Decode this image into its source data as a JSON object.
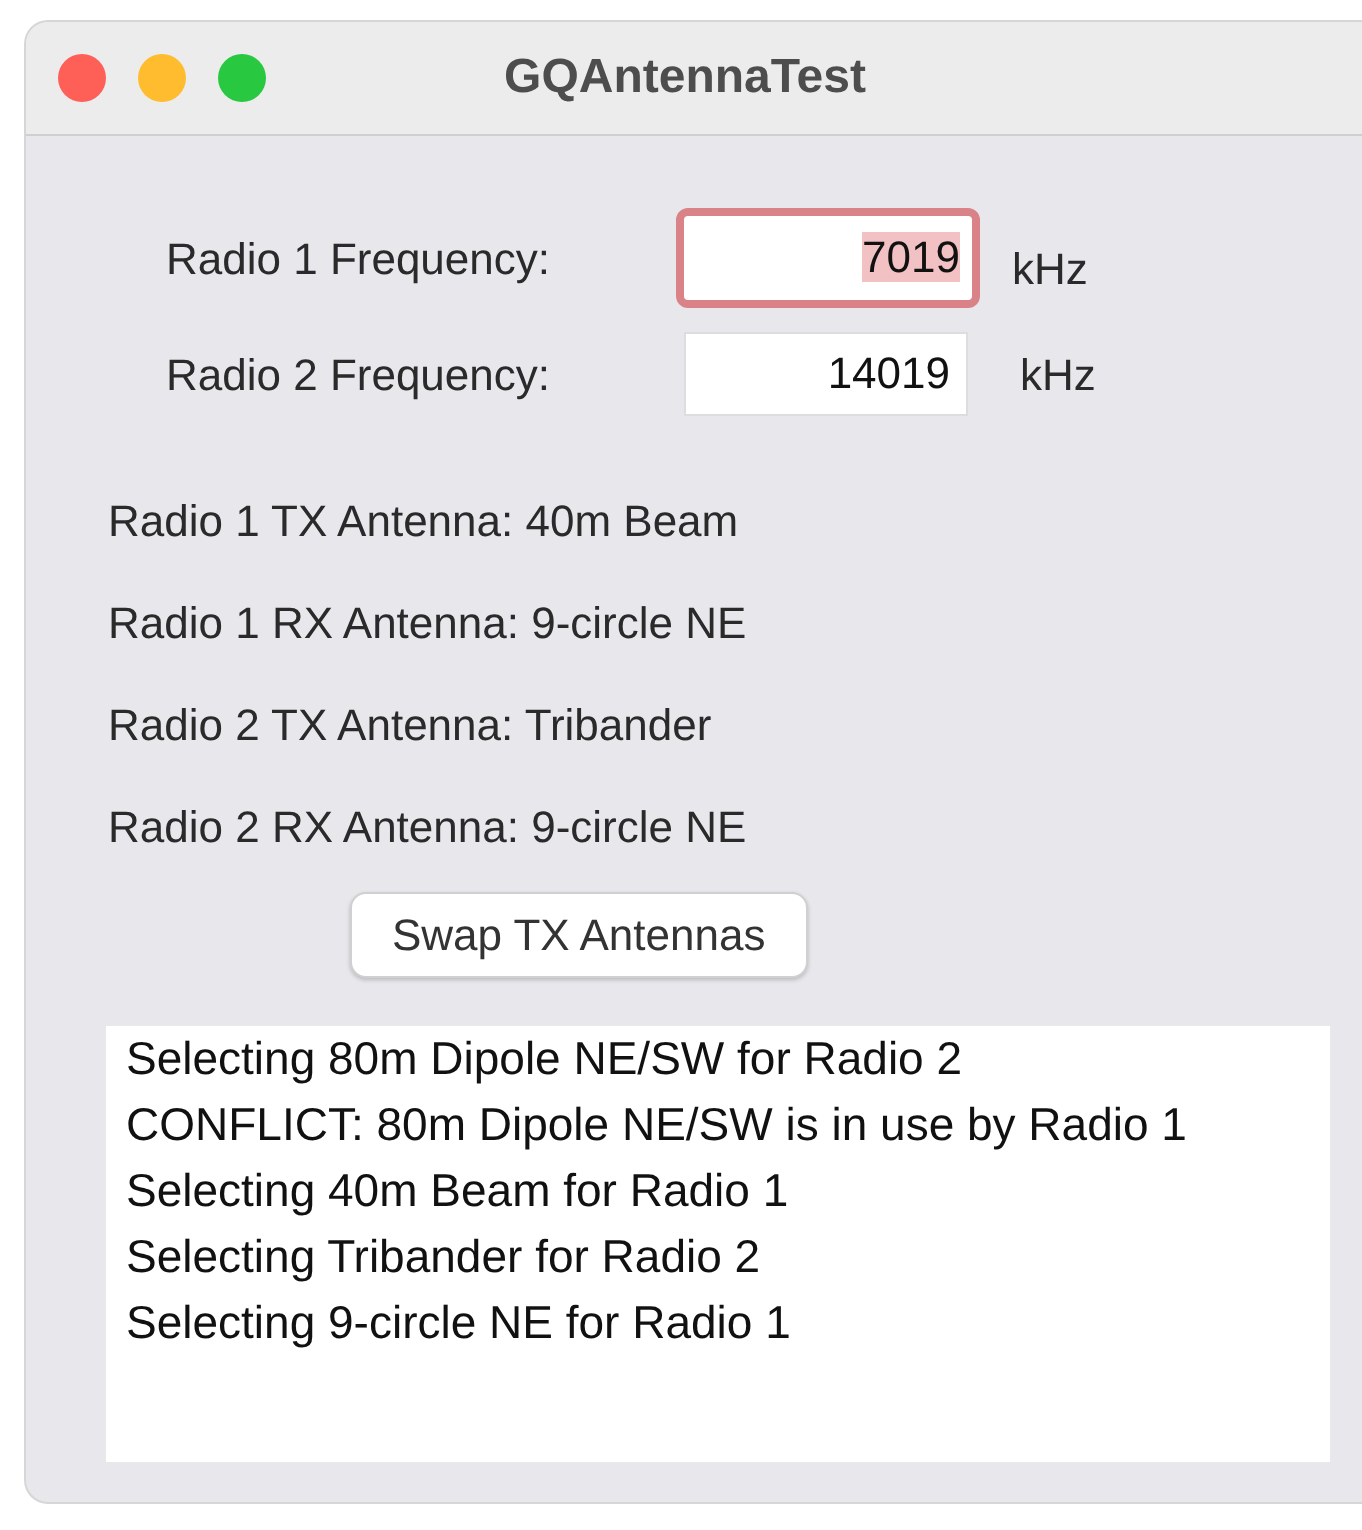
{
  "window": {
    "title": "GQAntennaTest"
  },
  "frequencies": [
    {
      "label": "Radio 1 Frequency:",
      "value": "7019",
      "unit": "kHz",
      "focused": true
    },
    {
      "label": "Radio 2 Frequency:",
      "value": "14019",
      "unit": "kHz",
      "focused": false
    }
  ],
  "antennas": [
    "Radio 1 TX Antenna: 40m Beam",
    "Radio 1 RX Antenna: 9-circle NE",
    "Radio 2 TX Antenna: Tribander",
    "Radio 2 RX Antenna: 9-circle NE"
  ],
  "swap_button": "Swap TX Antennas",
  "log": [
    "Selecting 80m Dipole NE/SW for Radio 2",
    "CONFLICT: 80m Dipole NE/SW is in use by Radio 1",
    "Selecting 40m Beam for Radio 1",
    "Selecting Tribander for Radio 2",
    "Selecting 9-circle NE for Radio 1"
  ]
}
